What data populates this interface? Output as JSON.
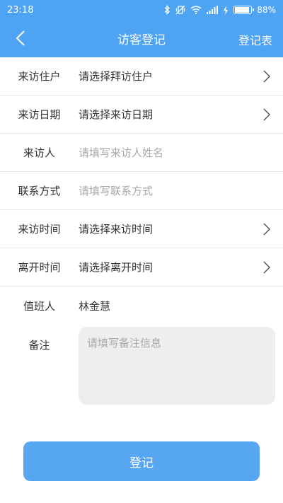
{
  "status_bar": {
    "time": "23:18",
    "battery": "88%",
    "battery_level": 0.88
  },
  "nav": {
    "title": "访客登记",
    "right_action": "登记表"
  },
  "form": {
    "resident": {
      "label": "来访住户",
      "placeholder": "请选择拜访住户"
    },
    "visit_date": {
      "label": "来访日期",
      "placeholder": "请选择来访日期"
    },
    "visitor": {
      "label": "来访人",
      "placeholder": "请填写来访人姓名",
      "value": ""
    },
    "contact": {
      "label": "联系方式",
      "placeholder": "请填写联系方式",
      "value": ""
    },
    "visit_time": {
      "label": "来访时间",
      "placeholder": "请选择来访时间"
    },
    "leave_time": {
      "label": "离开时间",
      "placeholder": "请选择离开时间"
    },
    "on_duty": {
      "label": "值班人",
      "value": "林金慧"
    },
    "notes": {
      "label": "备注",
      "placeholder": "请填写备注信息",
      "value": ""
    }
  },
  "submit_label": "登记",
  "colors": {
    "primary": "#4fa3f3",
    "button": "#57a6f2",
    "placeholder": "#a8a8a8",
    "notes_bg": "#eeeeee"
  }
}
